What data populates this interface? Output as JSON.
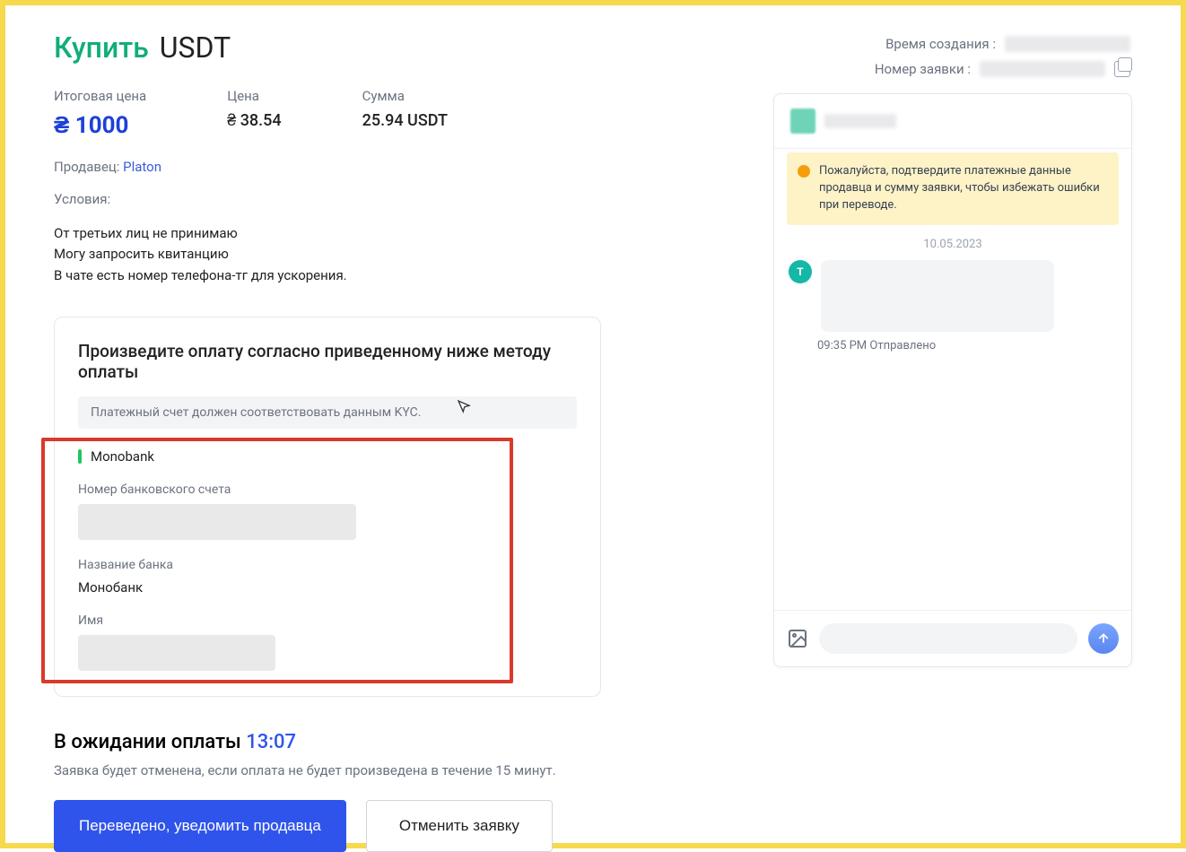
{
  "title": {
    "action": "Купить",
    "asset": "USDT"
  },
  "meta": {
    "created_label": "Время создания :",
    "order_label": "Номер заявки :"
  },
  "prices": {
    "total_label": "Итоговая цена",
    "total_value": "₴ 1000",
    "price_label": "Цена",
    "price_value": "₴ 38.54",
    "amount_label": "Сумма",
    "amount_value": "25.94 USDT"
  },
  "seller": {
    "label": "Продавец:",
    "name": "Platon"
  },
  "terms": {
    "label": "Условия:",
    "text": "От третьих лиц не принимаю\nМогу запросить квитанцию\nВ чате есть номер телефона-тг для ускорения."
  },
  "payment": {
    "heading": "Произведите оплату согласно приведенному ниже методу оплаты",
    "kyc_note": "Платежный счет должен соответствовать данным KYC.",
    "method": "Monobank",
    "account_label": "Номер банковского счета",
    "bank_label": "Название банка",
    "bank_value": "Монобанк",
    "name_label": "Имя"
  },
  "pending": {
    "heading": "В ожидании оплаты",
    "timer": "13:07",
    "note": "Заявка будет отменена, если оплата не будет произведена в течение 15 минут."
  },
  "buttons": {
    "primary": "Переведено, уведомить продавца",
    "secondary": "Отменить заявку"
  },
  "chat": {
    "notice": "Пожалуйста, подтвердите платежные данные продавца и сумму заявки, чтобы избежать ошибки при переводе.",
    "date": "10.05.2023",
    "msg_avatar_letter": "T",
    "msg_time": "09:35 PM",
    "msg_status": "Отправлено"
  }
}
